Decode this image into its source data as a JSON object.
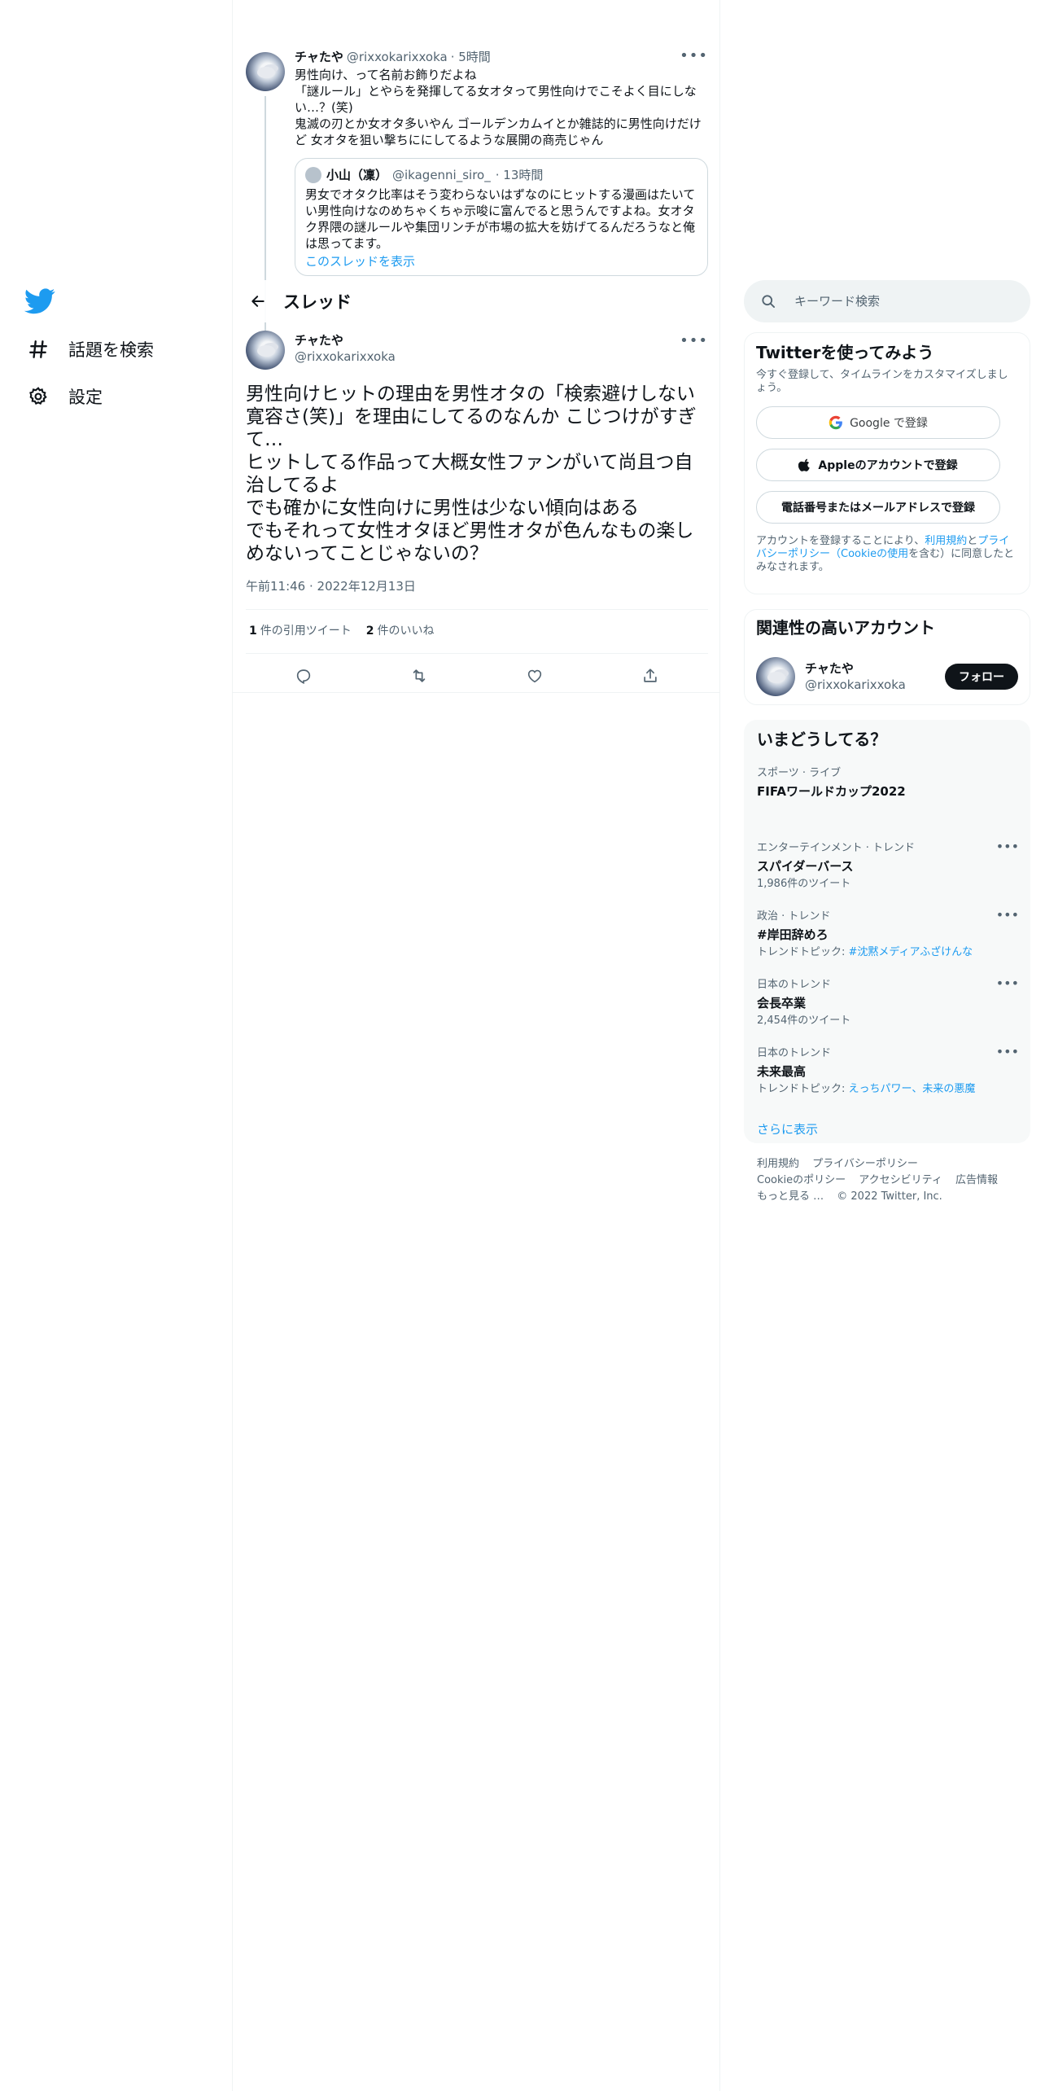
{
  "nav": {
    "explore_label": "話題を検索",
    "settings_label": "設定"
  },
  "parent_tweet": {
    "name": "チャたや",
    "handle": "@rixxokarixxoka",
    "time": "· 5時間",
    "text": "男性向け、って名前お飾りだよね\n「謎ルール」とやらを発揮してる女オタって男性向けでこそよく目にしない…？(笑)\n鬼滅の刃とか女オタ多いやん ゴールデンカムイとか雑誌的に男性向けだけど 女オタを狙い撃ちににしてるような展開の商売じゃん",
    "quote": {
      "name": "小山（凜）",
      "handle": "@ikagenni_siro_",
      "time": "· 13時間",
      "text": "男女でオタク比率はそう変わらないはずなのにヒットする漫画はたいてい男性向けなのめちゃくちゃ示唆に富んでると思うんですよね。女オタク界隈の謎ルールや集団リンチが市場の拡大を妨げてるんだろうなと俺は思ってます。",
      "show_thread": "このスレッドを表示"
    }
  },
  "thread_header": {
    "title": "スレッド"
  },
  "focus_tweet": {
    "name": "チャたや",
    "handle": "@rixxokarixxoka",
    "text": "男性向けヒットの理由を男性オタの「検索避けしない寛容さ(笑)」を理由にしてるのなんか こじつけがすぎて…\nヒットしてる作品って大概女性ファンがいて尚且つ自治してるよ\nでも確かに女性向けに男性は少ない傾向はある\nでもそれって女性オタほど男性オタが色んなもの楽しめないってことじゃないの？",
    "timestamp": "午前11:46 · 2022年12月13日",
    "quote_count": "1",
    "quote_label": "件の引用ツイート",
    "like_count": "2",
    "like_label": "件のいいね"
  },
  "search": {
    "placeholder": "キーワード検索"
  },
  "signup": {
    "title": "Twitterを使ってみよう",
    "subtitle": "今すぐ登録して、タイムラインをカスタマイズしましょう。",
    "google_label": "Google で登録",
    "apple_label": "Appleのアカウントで登録",
    "phone_label": "電話番号またはメールアドレスで登録",
    "legal_prefix": "アカウントを登録することにより、",
    "legal_terms": "利用規約",
    "legal_and": "と",
    "legal_privacy": "プライバシーポリシー",
    "legal_open": "（",
    "legal_cookie": "Cookieの使用",
    "legal_suffix": "を含む）に同意したとみなされます。"
  },
  "related": {
    "title": "関連性の高いアカウント",
    "name": "チャたや",
    "handle": "@rixxokarixxoka",
    "follow_label": "フォロー"
  },
  "trends": {
    "title": "いまどうしてる？",
    "items": [
      {
        "category": "スポーツ · ライブ",
        "name": "FIFAワールドカップ2022",
        "detail": ""
      },
      {
        "category": "エンターテインメント · トレンド",
        "name": "スパイダーバース",
        "detail": "1,986件のツイート"
      },
      {
        "category": "政治 · トレンド",
        "name": "#岸田辞めろ",
        "detail_prefix": "トレンドトピック: ",
        "detail_link": "#沈黙メディアふざけんな"
      },
      {
        "category": "日本のトレンド",
        "name": "会長卒業",
        "detail": "2,454件のツイート"
      },
      {
        "category": "日本のトレンド",
        "name": "未来最高",
        "detail_prefix": "トレンドトピック: ",
        "detail_link": "えっちパワー、未来の悪魔"
      }
    ],
    "show_more": "さらに表示"
  },
  "footer": {
    "terms": "利用規約",
    "privacy": "プライバシーポリシー",
    "cookie": "Cookieのポリシー",
    "accessibility": "アクセシビリティ",
    "ads": "広告情報",
    "more": "もっと見る …",
    "copyright": "© 2022 Twitter, Inc."
  },
  "colors": {
    "accent": "#1d9bf0",
    "text": "#0f1419",
    "secondary": "#536471",
    "border": "#eff3f4"
  }
}
